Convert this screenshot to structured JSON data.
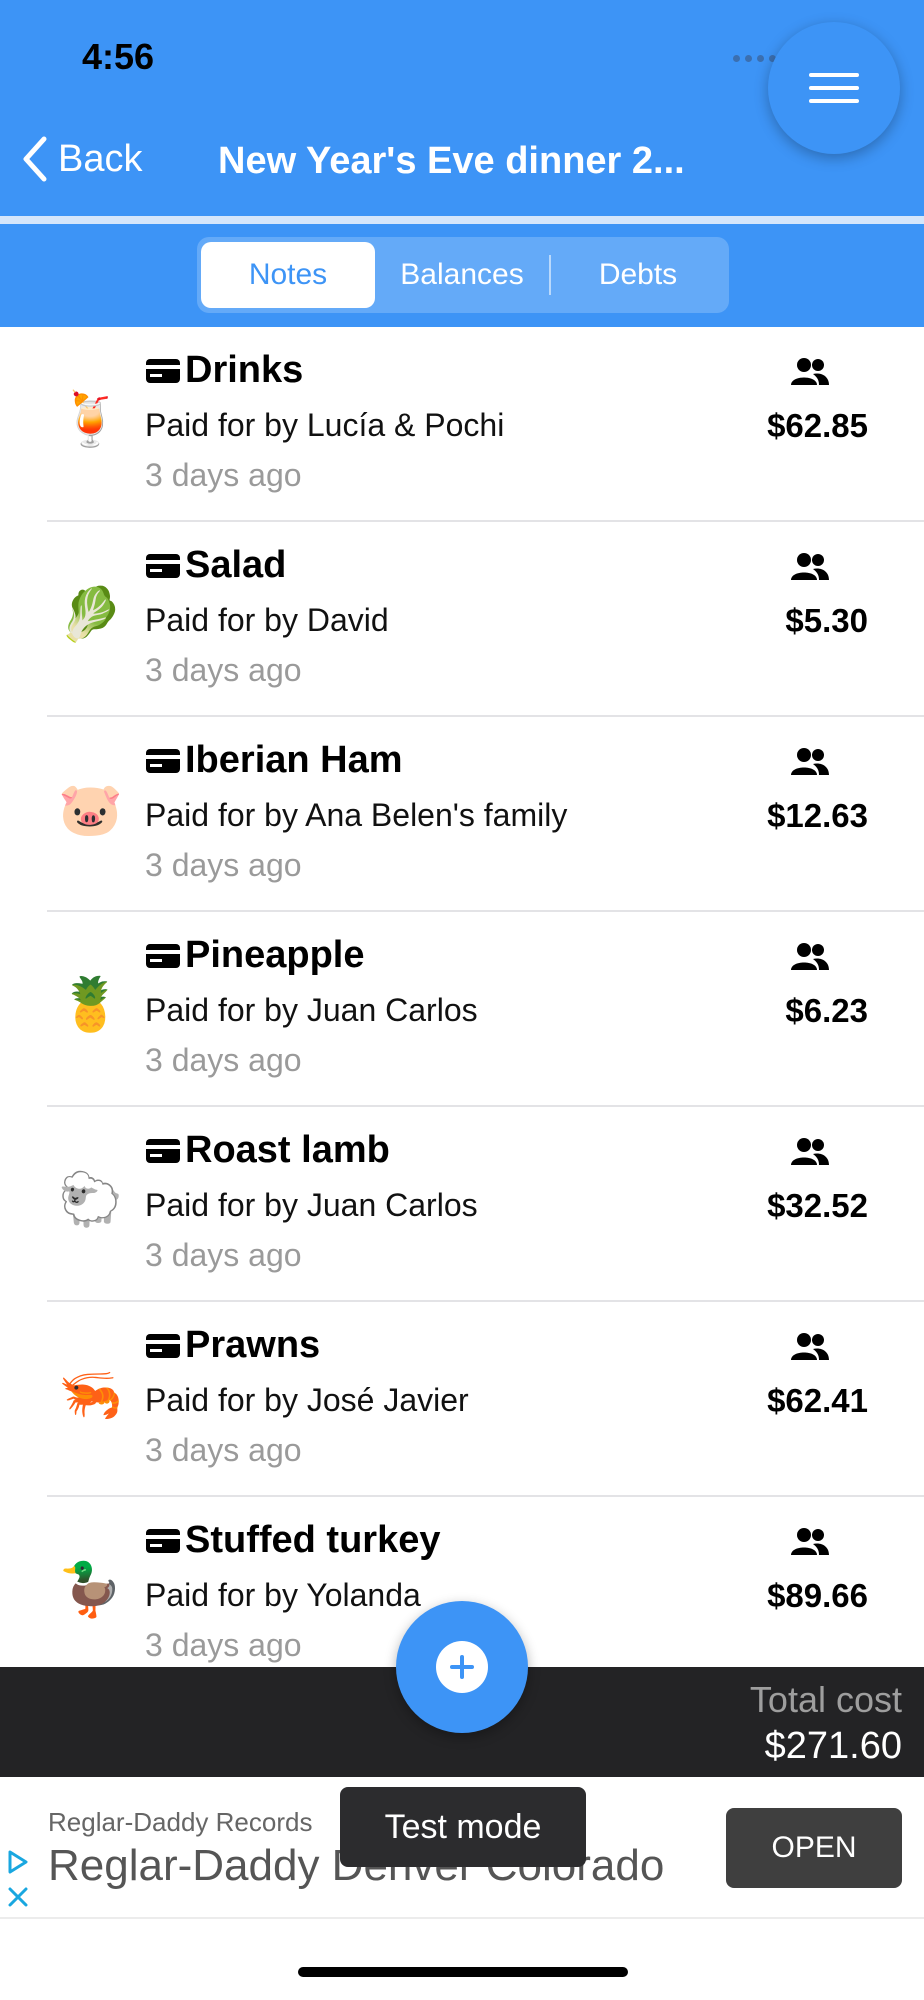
{
  "status_bar": {
    "time": "4:56"
  },
  "nav": {
    "back_label": "Back",
    "title": "New Year's Eve dinner 2..."
  },
  "tabs": [
    {
      "label": "Notes",
      "active": true
    },
    {
      "label": "Balances",
      "active": false
    },
    {
      "label": "Debts",
      "active": false
    }
  ],
  "notes": [
    {
      "emoji": "🍹",
      "icon": "cocktail-icon",
      "title": "Drinks",
      "payer": "Paid for by Lucía & Pochi",
      "time": "3 days ago",
      "amount": "$62.85"
    },
    {
      "emoji": "🥬",
      "icon": "lettuce-icon",
      "title": "Salad",
      "payer": "Paid for by David",
      "time": "3 days ago",
      "amount": "$5.30"
    },
    {
      "emoji": "🐷",
      "icon": "pig-icon",
      "title": "Iberian Ham",
      "payer": "Paid for by Ana Belen's family",
      "time": "3 days ago",
      "amount": "$12.63"
    },
    {
      "emoji": "🍍",
      "icon": "pineapple-icon",
      "title": "Pineapple",
      "payer": "Paid for by Juan Carlos",
      "time": "3 days ago",
      "amount": "$6.23"
    },
    {
      "emoji": "🐑",
      "icon": "sheep-icon",
      "title": "Roast lamb",
      "payer": "Paid for by Juan Carlos",
      "time": "3 days ago",
      "amount": "$32.52"
    },
    {
      "emoji": "🦐",
      "icon": "shrimp-icon",
      "title": "Prawns",
      "payer": "Paid for by José Javier",
      "time": "3 days ago",
      "amount": "$62.41"
    },
    {
      "emoji": "🦆",
      "icon": "duck-icon",
      "title": "Stuffed turkey",
      "payer": "Paid for by Yolanda",
      "time": "3 days ago",
      "amount": "$89.66"
    }
  ],
  "total": {
    "label": "Total cost",
    "value": "$271.60"
  },
  "ad": {
    "advertiser": "Reglar-Daddy Records",
    "headline": "Reglar-Daddy Denver Colorado",
    "cta": "OPEN"
  },
  "test_mode_label": "Test mode",
  "colors": {
    "primary": "#3d94f6",
    "dark_bar": "#232325",
    "muted_text": "#9a9a9a"
  }
}
